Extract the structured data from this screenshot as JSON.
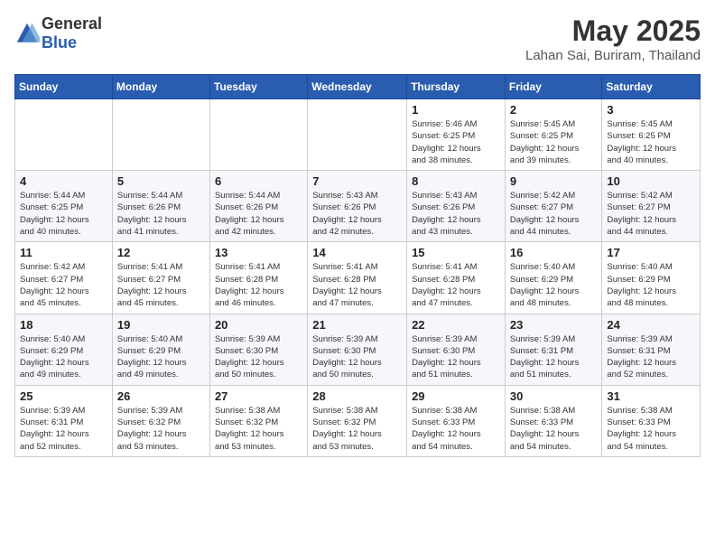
{
  "header": {
    "logo_general": "General",
    "logo_blue": "Blue",
    "month_year": "May 2025",
    "location": "Lahan Sai, Buriram, Thailand"
  },
  "weekdays": [
    "Sunday",
    "Monday",
    "Tuesday",
    "Wednesday",
    "Thursday",
    "Friday",
    "Saturday"
  ],
  "weeks": [
    [
      {
        "day": "",
        "info": ""
      },
      {
        "day": "",
        "info": ""
      },
      {
        "day": "",
        "info": ""
      },
      {
        "day": "",
        "info": ""
      },
      {
        "day": "1",
        "info": "Sunrise: 5:46 AM\nSunset: 6:25 PM\nDaylight: 12 hours\nand 38 minutes."
      },
      {
        "day": "2",
        "info": "Sunrise: 5:45 AM\nSunset: 6:25 PM\nDaylight: 12 hours\nand 39 minutes."
      },
      {
        "day": "3",
        "info": "Sunrise: 5:45 AM\nSunset: 6:25 PM\nDaylight: 12 hours\nand 40 minutes."
      }
    ],
    [
      {
        "day": "4",
        "info": "Sunrise: 5:44 AM\nSunset: 6:25 PM\nDaylight: 12 hours\nand 40 minutes."
      },
      {
        "day": "5",
        "info": "Sunrise: 5:44 AM\nSunset: 6:26 PM\nDaylight: 12 hours\nand 41 minutes."
      },
      {
        "day": "6",
        "info": "Sunrise: 5:44 AM\nSunset: 6:26 PM\nDaylight: 12 hours\nand 42 minutes."
      },
      {
        "day": "7",
        "info": "Sunrise: 5:43 AM\nSunset: 6:26 PM\nDaylight: 12 hours\nand 42 minutes."
      },
      {
        "day": "8",
        "info": "Sunrise: 5:43 AM\nSunset: 6:26 PM\nDaylight: 12 hours\nand 43 minutes."
      },
      {
        "day": "9",
        "info": "Sunrise: 5:42 AM\nSunset: 6:27 PM\nDaylight: 12 hours\nand 44 minutes."
      },
      {
        "day": "10",
        "info": "Sunrise: 5:42 AM\nSunset: 6:27 PM\nDaylight: 12 hours\nand 44 minutes."
      }
    ],
    [
      {
        "day": "11",
        "info": "Sunrise: 5:42 AM\nSunset: 6:27 PM\nDaylight: 12 hours\nand 45 minutes."
      },
      {
        "day": "12",
        "info": "Sunrise: 5:41 AM\nSunset: 6:27 PM\nDaylight: 12 hours\nand 45 minutes."
      },
      {
        "day": "13",
        "info": "Sunrise: 5:41 AM\nSunset: 6:28 PM\nDaylight: 12 hours\nand 46 minutes."
      },
      {
        "day": "14",
        "info": "Sunrise: 5:41 AM\nSunset: 6:28 PM\nDaylight: 12 hours\nand 47 minutes."
      },
      {
        "day": "15",
        "info": "Sunrise: 5:41 AM\nSunset: 6:28 PM\nDaylight: 12 hours\nand 47 minutes."
      },
      {
        "day": "16",
        "info": "Sunrise: 5:40 AM\nSunset: 6:29 PM\nDaylight: 12 hours\nand 48 minutes."
      },
      {
        "day": "17",
        "info": "Sunrise: 5:40 AM\nSunset: 6:29 PM\nDaylight: 12 hours\nand 48 minutes."
      }
    ],
    [
      {
        "day": "18",
        "info": "Sunrise: 5:40 AM\nSunset: 6:29 PM\nDaylight: 12 hours\nand 49 minutes."
      },
      {
        "day": "19",
        "info": "Sunrise: 5:40 AM\nSunset: 6:29 PM\nDaylight: 12 hours\nand 49 minutes."
      },
      {
        "day": "20",
        "info": "Sunrise: 5:39 AM\nSunset: 6:30 PM\nDaylight: 12 hours\nand 50 minutes."
      },
      {
        "day": "21",
        "info": "Sunrise: 5:39 AM\nSunset: 6:30 PM\nDaylight: 12 hours\nand 50 minutes."
      },
      {
        "day": "22",
        "info": "Sunrise: 5:39 AM\nSunset: 6:30 PM\nDaylight: 12 hours\nand 51 minutes."
      },
      {
        "day": "23",
        "info": "Sunrise: 5:39 AM\nSunset: 6:31 PM\nDaylight: 12 hours\nand 51 minutes."
      },
      {
        "day": "24",
        "info": "Sunrise: 5:39 AM\nSunset: 6:31 PM\nDaylight: 12 hours\nand 52 minutes."
      }
    ],
    [
      {
        "day": "25",
        "info": "Sunrise: 5:39 AM\nSunset: 6:31 PM\nDaylight: 12 hours\nand 52 minutes."
      },
      {
        "day": "26",
        "info": "Sunrise: 5:39 AM\nSunset: 6:32 PM\nDaylight: 12 hours\nand 53 minutes."
      },
      {
        "day": "27",
        "info": "Sunrise: 5:38 AM\nSunset: 6:32 PM\nDaylight: 12 hours\nand 53 minutes."
      },
      {
        "day": "28",
        "info": "Sunrise: 5:38 AM\nSunset: 6:32 PM\nDaylight: 12 hours\nand 53 minutes."
      },
      {
        "day": "29",
        "info": "Sunrise: 5:38 AM\nSunset: 6:33 PM\nDaylight: 12 hours\nand 54 minutes."
      },
      {
        "day": "30",
        "info": "Sunrise: 5:38 AM\nSunset: 6:33 PM\nDaylight: 12 hours\nand 54 minutes."
      },
      {
        "day": "31",
        "info": "Sunrise: 5:38 AM\nSunset: 6:33 PM\nDaylight: 12 hours\nand 54 minutes."
      }
    ]
  ]
}
